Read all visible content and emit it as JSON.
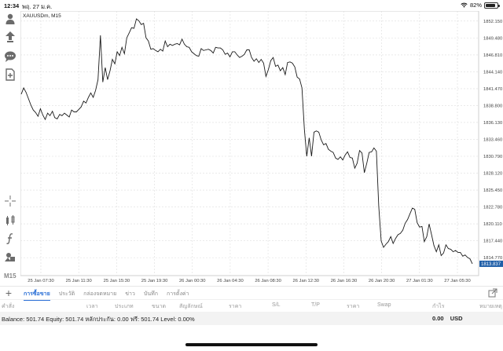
{
  "status_bar": {
    "time": "12:34",
    "date": "พฤ. 27 ม.ค.",
    "battery": "82%",
    "battery_level": 0.82
  },
  "left_toolbar": {
    "tools": [
      "account-icon",
      "trade-icon",
      "chat-icon",
      "new-document-icon",
      "crosshair-icon",
      "indicators-icon",
      "function-icon",
      "objects-icon"
    ],
    "timeframe": "M15"
  },
  "chart": {
    "symbol_label": "XAUUSDm, M15",
    "current_price_label": "1813.837",
    "colors": {
      "line": "#1a1a1a",
      "grid": "#dddddd",
      "price_tag": "#1f5fa8"
    },
    "grid": "dashed",
    "chart_data": {
      "type": "line",
      "title": "XAUUSDm, M15",
      "ylim": [
        1812.8,
        1853.0
      ],
      "y_ticks": [
        "1852.150",
        "1849.480",
        "1846.810",
        "1844.140",
        "1841.470",
        "1838.800",
        "1836.130",
        "1833.460",
        "1830.790",
        "1828.120",
        "1825.450",
        "1822.780",
        "1820.110",
        "1817.440",
        "1814.770"
      ],
      "y_tick_values": [
        1852.15,
        1849.48,
        1846.81,
        1844.14,
        1841.47,
        1838.8,
        1836.13,
        1833.46,
        1830.79,
        1828.12,
        1825.45,
        1822.78,
        1820.11,
        1817.44,
        1814.77
      ],
      "x_ticks": [
        "25 Jan 07:30",
        "25 Jan 11:30",
        "25 Jan 15:30",
        "25 Jan 19:30",
        "26 Jan 00:30",
        "26 Jan 04:30",
        "26 Jan 08:30",
        "26 Jan 12:30",
        "26 Jan 16:30",
        "26 Jan 20:30",
        "27 Jan 01:30",
        "27 Jan 05:30"
      ],
      "series": [
        {
          "values": [
            1840.6,
            1841.6,
            1840.9,
            1839.9,
            1838.9,
            1838.1,
            1837.7,
            1837.1,
            1838.3,
            1837.3,
            1836.6,
            1837.6,
            1837.2,
            1837.9,
            1836.9,
            1836.7,
            1837.4,
            1837.2,
            1837.6,
            1837.3,
            1837.0,
            1838.1,
            1837.8,
            1837.8,
            1838.2,
            1838.6,
            1839.5,
            1839.2,
            1840.1,
            1840.8,
            1840.1,
            1841.2,
            1842.9,
            1849.9,
            1842.5,
            1844.8,
            1842.9,
            1844.3,
            1846.1,
            1845.4,
            1847.3,
            1846.7,
            1848.0,
            1847.0,
            1849.5,
            1850.3,
            1851.1,
            1851.0,
            1852.5,
            1852.2,
            1851.6,
            1851.8,
            1849.5,
            1849.0,
            1847.7,
            1847.8,
            1847.5,
            1847.3,
            1847.7,
            1847.4,
            1849.0,
            1848.1,
            1848.5,
            1848.3,
            1848.5,
            1848.6,
            1848.4,
            1849.3,
            1848.5,
            1848.1,
            1848.0,
            1847.3,
            1847.0,
            1846.7,
            1846.6,
            1847.8,
            1847.5,
            1847.6,
            1847.7,
            1847.5,
            1847.1,
            1848.0,
            1847.9,
            1847.9,
            1847.6,
            1846.9,
            1847.1,
            1846.5,
            1847.3,
            1847.3,
            1846.8,
            1846.4,
            1846.6,
            1846.9,
            1847.6,
            1847.6,
            1846.4,
            1845.8,
            1846.2,
            1845.6,
            1846.1,
            1845.5,
            1843.4,
            1844.5,
            1845.9,
            1846.4,
            1845.0,
            1845.2,
            1844.3,
            1844.8,
            1843.7,
            1845.6,
            1845.7,
            1845.5,
            1844.9,
            1843.3,
            1843.0,
            1841.6,
            1835.0,
            1830.8,
            1833.7,
            1830.8,
            1834.6,
            1834.8,
            1834.6,
            1833.4,
            1832.6,
            1832.8,
            1831.9,
            1831.6,
            1831.4,
            1830.5,
            1830.3,
            1830.7,
            1830.2,
            1831.0,
            1831.5,
            1830.6,
            1830.5,
            1828.9,
            1829.7,
            1831.7,
            1831.3,
            1828.2,
            1829.7,
            1831.4,
            1831.5,
            1832.1,
            1831.6,
            1822.9,
            1817.4,
            1816.4,
            1816.9,
            1817.3,
            1818.1,
            1817.0,
            1817.8,
            1818.4,
            1818.6,
            1819.1,
            1820.2,
            1820.8,
            1821.7,
            1822.6,
            1822.4,
            1820.3,
            1819.6,
            1819.7,
            1817.3,
            1818.1,
            1820.1,
            1818.4,
            1816.7,
            1815.7,
            1816.8,
            1815.1,
            1815.5,
            1816.8,
            1816.2,
            1816.1,
            1815.7,
            1815.9,
            1815.6,
            1815.6,
            1815.0,
            1815.2,
            1814.8,
            1814.6,
            1813.8
          ]
        }
      ]
    }
  },
  "tabs": {
    "add_label": "+",
    "items": [
      {
        "label": "การซื้อขาย",
        "active": true
      },
      {
        "label": "ประวัติ",
        "active": false
      },
      {
        "label": "กล่องจดหมาย",
        "active": false
      },
      {
        "label": "ข่าว",
        "active": false
      },
      {
        "label": "บันทึก",
        "active": false
      },
      {
        "label": "การตั้งค่า",
        "active": false
      }
    ]
  },
  "columns": [
    "คำสั่ง",
    "เวลา",
    "ประเภท",
    "ขนาด",
    "สัญลักษณ์",
    "ราคา",
    "S/L",
    "T/P",
    "ราคา",
    "Swap",
    "กำไร",
    "หมายเหตุ"
  ],
  "balance_bar": {
    "text": "Balance: 501.74 Equity: 501.74 หลักประกัน: 0.00 ฟรี: 501.74 Level: 0.00%",
    "profit": "0.00",
    "currency": "USD"
  }
}
